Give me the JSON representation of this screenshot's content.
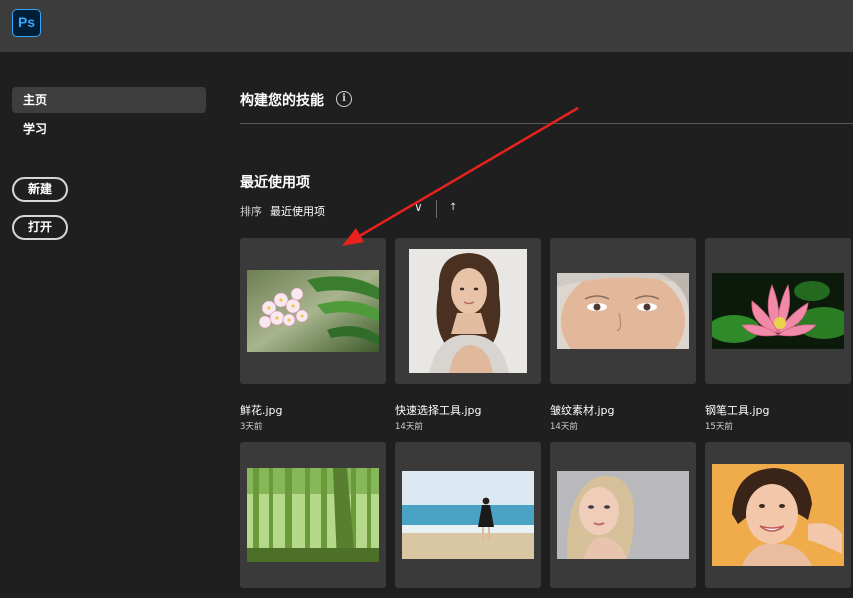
{
  "app": {
    "logo_text": "Ps"
  },
  "sidebar": {
    "items": [
      {
        "label": "主页",
        "active": true
      },
      {
        "label": "学习",
        "active": false
      }
    ],
    "new_button": "新建",
    "open_button": "打开"
  },
  "skills": {
    "title": "构建您的技能",
    "info_icon": "i"
  },
  "recent": {
    "title": "最近使用项",
    "sort_label": "排序",
    "sort_value": "最近使用项",
    "files": [
      {
        "name": "鲜花.jpg",
        "time": "3天前",
        "thumb": "flower-photo"
      },
      {
        "name": "快速选择工具.jpg",
        "time": "14天前",
        "thumb": "woman-portrait-photo"
      },
      {
        "name": "皱纹素材.jpg",
        "time": "14天前",
        "thumb": "elderly-face-photo"
      },
      {
        "name": "钢笔工具.jpg",
        "time": "15天前",
        "thumb": "lotus-photo"
      },
      {
        "name": "",
        "time": "",
        "thumb": "bamboo-photo"
      },
      {
        "name": "",
        "time": "",
        "thumb": "beach-photo"
      },
      {
        "name": "",
        "time": "",
        "thumb": "blonde-portrait-photo"
      },
      {
        "name": "",
        "time": "",
        "thumb": "smiling-woman-photo"
      }
    ]
  },
  "colors": {
    "accent": "#31a8ff",
    "annotation_arrow": "#e8221c"
  }
}
